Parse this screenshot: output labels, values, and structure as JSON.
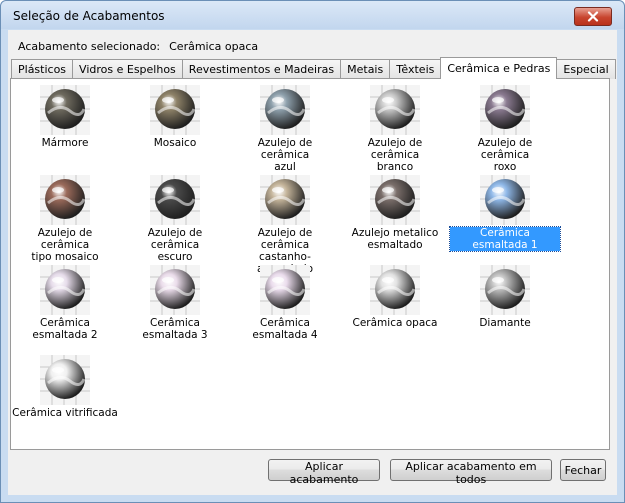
{
  "window": {
    "title": "Seleção de Acabamentos"
  },
  "selection": {
    "label": "Acabamento selecionado:",
    "value": "Cerâmica opaca"
  },
  "tabs": [
    {
      "label": "Plásticos",
      "active": false
    },
    {
      "label": "Vidros e Espelhos",
      "active": false
    },
    {
      "label": "Revestimentos e Madeiras",
      "active": false
    },
    {
      "label": "Metais",
      "active": false
    },
    {
      "label": "Têxteis",
      "active": false
    },
    {
      "label": "Cerâmica e Pedras",
      "active": true
    },
    {
      "label": "Especial",
      "active": false
    }
  ],
  "materials": [
    {
      "line1": "Mármore",
      "line2": "",
      "color": "#6e6a5e",
      "icon": "marble-icon",
      "selected": false
    },
    {
      "line1": "Mosaico",
      "line2": "",
      "color": "#8e8268",
      "icon": "mosaic-icon",
      "selected": false
    },
    {
      "line1": "Azulejo de cerâmica",
      "line2": "azul",
      "color": "#8ea0ac",
      "icon": "blue-tile-icon",
      "selected": false
    },
    {
      "line1": "Azulejo de cerâmica",
      "line2": "branco",
      "color": "#c8c8c8",
      "icon": "white-tile-icon",
      "selected": false
    },
    {
      "line1": "Azulejo de cerâmica",
      "line2": "roxo",
      "color": "#8a7a90",
      "icon": "purple-tile-icon",
      "selected": false
    },
    {
      "line1": "Azulejo de cerâmica",
      "line2": "tipo mosaico",
      "color": "#9a6a5a",
      "icon": "mosaic-tile-icon",
      "selected": false
    },
    {
      "line1": "Azulejo de cerâmica",
      "line2": "escuro",
      "color": "#4a4a4a",
      "icon": "dark-tile-icon",
      "selected": false
    },
    {
      "line1": "Azulejo de cerâmica",
      "line2": "castanho-amarelado",
      "color": "#c4b49a",
      "icon": "tan-tile-icon",
      "selected": false
    },
    {
      "line1": "Azulejo metalico",
      "line2": "esmaltado",
      "color": "#7a6e6a",
      "icon": "metallic-tile-icon",
      "selected": false
    },
    {
      "line1": "Cerâmica esmaltada 1",
      "line2": "",
      "color": "#8fb8e8",
      "icon": "glazed-ceramic-1-icon",
      "selected": true
    },
    {
      "line1": "Cerâmica esmaltada 2",
      "line2": "",
      "color": "#e6dcea",
      "icon": "glazed-ceramic-2-icon",
      "selected": false
    },
    {
      "line1": "Cerâmica esmaltada 3",
      "line2": "",
      "color": "#eadcea",
      "icon": "glazed-ceramic-3-icon",
      "selected": false
    },
    {
      "line1": "Cerâmica esmaltada 4",
      "line2": "",
      "color": "#eadcec",
      "icon": "glazed-ceramic-4-icon",
      "selected": false
    },
    {
      "line1": "Cerâmica opaca",
      "line2": "",
      "color": "#e2e2e2",
      "icon": "opaque-ceramic-icon",
      "selected": false
    },
    {
      "line1": "Diamante",
      "line2": "",
      "color": "#bdbdbd",
      "icon": "diamond-icon",
      "selected": false
    },
    {
      "line1": "Cerâmica vitrificada",
      "line2": "",
      "color": "#f0f0f0",
      "icon": "vitrified-ceramic-icon",
      "selected": false
    }
  ],
  "buttons": {
    "apply": "Aplicar acabamento",
    "apply_all": "Aplicar acabamento em todos",
    "close": "Fechar"
  },
  "colors": {
    "selection_highlight": "#3399ff",
    "close_button": "#c8452f"
  }
}
